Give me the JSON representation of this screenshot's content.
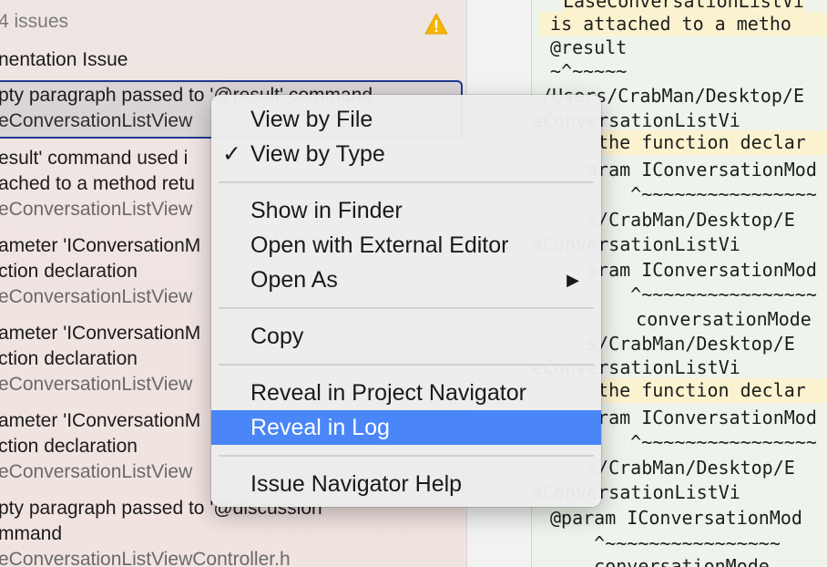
{
  "navigator": {
    "issue_count": "4 issues",
    "group_title": "nentation Issue",
    "rows": [
      {
        "text": "pty paragraph passed to '@result' command",
        "sub": "eConversationListView"
      },
      {
        "text": "esult' command used i",
        "text2": "ached to a method retu",
        "sub": "eConversationListView"
      },
      {
        "text": "ameter 'IConversationM",
        "text2": "ction declaration",
        "sub": "eConversationListView"
      },
      {
        "text": "ameter 'IConversationM",
        "text2": "ction declaration",
        "sub": "eConversationListView"
      },
      {
        "text": "ameter 'IConversationM",
        "text2": "ction declaration",
        "sub": "eConversationListView"
      },
      {
        "text": "pty paragraph passed to '@discussion",
        "text2": "mmand",
        "sub": "eConversationListViewController.h"
      }
    ]
  },
  "log": {
    "lines": [
      "LaseConversationListVi",
      " is attached to a metho",
      "@result",
      "~^~~~~~",
      "/Users/CrabMan/Desktop/E",
      "eConversationListVi",
      " the function declar",
      "aram IConversationMod",
      "    ^~~~~~~~~~~~~~~~~",
      "s/CrabMan/Desktop/E",
      "eConversationListVi",
      "aram IConversationMod",
      "    ^~~~~~~~~~~~~~~~~",
      "    conversationMode",
      "s/CrabMan/Desktop/E",
      "eConversationListVi",
      " the function declar",
      "aram IConversationMod",
      "    ^~~~~~~~~~~~~~~~~",
      "s/CrabMan/Desktop/E",
      "eConversationListVi",
      "@param IConversationMod",
      "    ^~~~~~~~~~~~~~~~~",
      "    conversationMode"
    ]
  },
  "menu": {
    "view_by_file": "View by File",
    "view_by_type": "View by Type",
    "checkmark": "✓",
    "show_in_finder": "Show in Finder",
    "open_external": "Open with External Editor",
    "open_as": "Open As",
    "submenu_arrow": "▶",
    "copy": "Copy",
    "reveal_project": "Reveal in Project Navigator",
    "reveal_log": "Reveal in Log",
    "help": "Issue Navigator Help"
  },
  "colors": {
    "selection": "#4a86f7",
    "warning": "#f5b400"
  }
}
